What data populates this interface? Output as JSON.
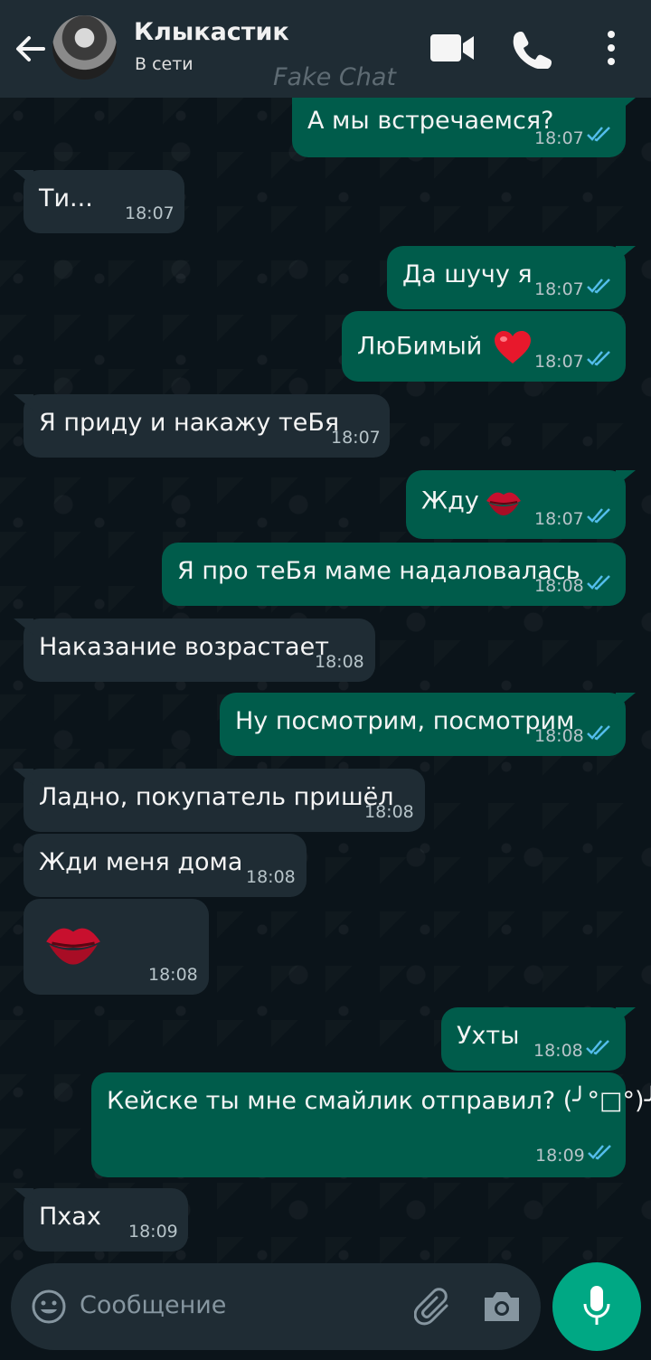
{
  "header": {
    "contact_name": "Клыкастик",
    "status": "В сети",
    "watermark": "Fake Chat",
    "icons": [
      "back-arrow-icon",
      "video-call-icon",
      "phone-icon",
      "more-options-icon"
    ]
  },
  "messages": [
    {
      "dir": "out",
      "text": "А мы встречаемся?",
      "time": "18:07"
    },
    {
      "dir": "in",
      "text": "Ти...",
      "time": "18:07"
    },
    {
      "dir": "out",
      "text": "Да шучу я",
      "time": "18:07"
    },
    {
      "dir": "out",
      "text": "ЛюБимый",
      "emoji": "red-heart",
      "time": "18:07"
    },
    {
      "dir": "in",
      "text": "Я приду и накажу теБя",
      "time": "18:07"
    },
    {
      "dir": "out",
      "text": "Жду",
      "emoji": "kiss-mark",
      "time": "18:07"
    },
    {
      "dir": "out",
      "text": "Я про теБя маме надаловалась",
      "time": "18:08"
    },
    {
      "dir": "in",
      "text": "Наказание возрастает",
      "time": "18:08"
    },
    {
      "dir": "out",
      "text": "Ну посмотрим, посмотрим",
      "time": "18:08"
    },
    {
      "dir": "in",
      "text": "Ладно, покупатель пришёл",
      "time": "18:08"
    },
    {
      "dir": "in",
      "text": "Жди меня дома",
      "time": "18:08"
    },
    {
      "dir": "in",
      "emoji": "kiss-mark",
      "time": "18:08"
    },
    {
      "dir": "out",
      "text": "Ухты",
      "time": "18:08"
    },
    {
      "dir": "out",
      "text": "Кейске ты мне смайлик отправил? (╯°□°)╯",
      "time": "18:09"
    },
    {
      "dir": "in",
      "text": "Пхах",
      "time": "18:09"
    }
  ],
  "composer": {
    "placeholder": "Сообщение",
    "icons": [
      "emoji-icon",
      "attach-icon",
      "camera-icon",
      "microphone-icon"
    ]
  },
  "colors": {
    "background": "#0b141a",
    "header": "#1f2c34",
    "incoming": "#1f2c34",
    "outgoing": "#005c4b",
    "accent": "#00a884",
    "read_ticks": "#53bdeb"
  }
}
